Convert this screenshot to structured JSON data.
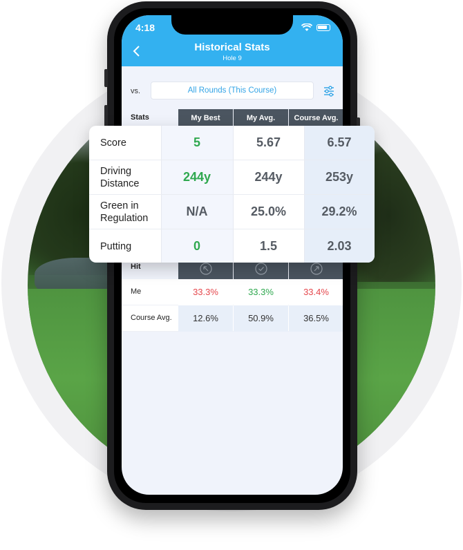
{
  "status": {
    "time": "4:18"
  },
  "nav": {
    "title": "Historical Stats",
    "subtitle": "Hole 9"
  },
  "compare": {
    "label": "vs.",
    "selected": "All Rounds (This Course)"
  },
  "stats_table": {
    "header_label": "Stats",
    "columns": [
      "My Best",
      "My Avg.",
      "Course Avg."
    ],
    "rows": [
      {
        "label": "Score",
        "values": [
          "5",
          "5.67",
          "6.57"
        ]
      },
      {
        "label": "Driving Distance",
        "values": [
          "244y",
          "244y",
          "253y"
        ]
      },
      {
        "label": "Green in Regulation",
        "values": [
          "N/A",
          "25.0%",
          "29.2%"
        ]
      },
      {
        "label": "Putting",
        "values": [
          "0",
          "1.5",
          "2.03"
        ]
      }
    ]
  },
  "hit_table": {
    "header_label": "Hit",
    "column_icons": [
      "arrow-up-left-icon",
      "check-icon",
      "arrow-up-right-icon"
    ],
    "rows": [
      {
        "label": "Me",
        "values": [
          "33.3%",
          "33.3%",
          "33.4%"
        ]
      },
      {
        "label": "Course Avg.",
        "values": [
          "12.6%",
          "50.9%",
          "36.5%"
        ]
      }
    ]
  },
  "colors": {
    "accent": "#33b1f0",
    "good": "#2fa84f",
    "bad": "#e5484d",
    "header_dark": "#4b5560"
  }
}
